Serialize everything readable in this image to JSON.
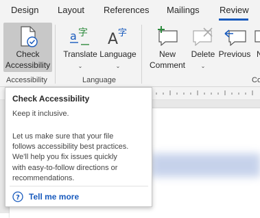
{
  "tabs": [
    {
      "label": "Design"
    },
    {
      "label": "Layout"
    },
    {
      "label": "References"
    },
    {
      "label": "Mailings"
    },
    {
      "label": "Review",
      "active": true
    }
  ],
  "ribbon": {
    "check_accessibility": {
      "line1": "Check",
      "line2": "Accessibility"
    },
    "accessibility_group": "Accessibility",
    "translate": "Translate",
    "language": "Language",
    "language_group": "Language",
    "new_comment": {
      "line1": "New",
      "line2": "Comment"
    },
    "delete": "Delete",
    "previous": "Previous",
    "next_partial": "N",
    "comments_group_partial": "Co"
  },
  "tooltip": {
    "title": "Check Accessibility",
    "subtitle": "Keep it inclusive.",
    "body_lines": [
      "Let us make sure that your file",
      "follows accessibility best practices.",
      "We'll help you fix issues quickly",
      "with easy-to-follow directions or",
      "recommendations."
    ],
    "help_link": "Tell me more"
  },
  "colors": {
    "accent": "#185abd",
    "ribbon_bg": "#f3f3f3",
    "selected_button": "#c8c8c8",
    "green_icon": "#2e8b3e"
  }
}
